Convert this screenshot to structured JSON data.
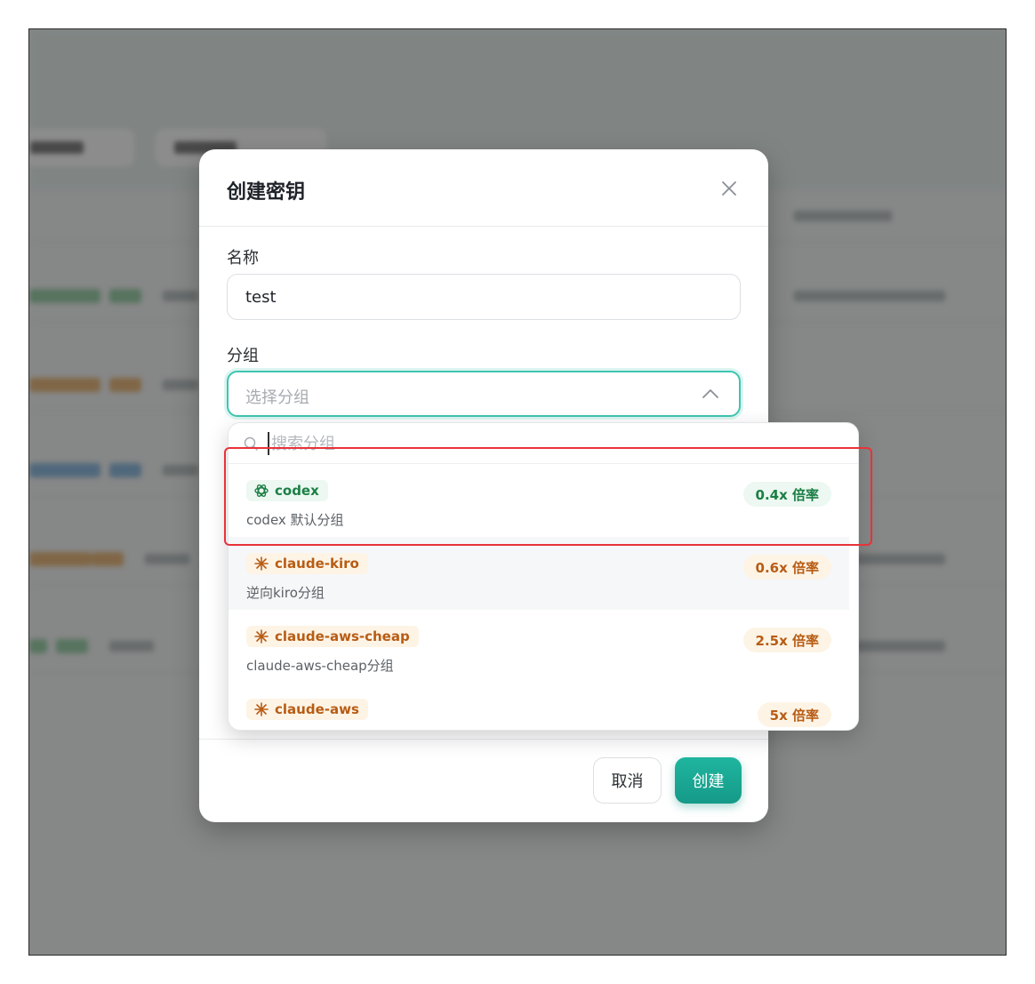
{
  "modal": {
    "title": "创建密钥",
    "name_label": "名称",
    "name_value": "test",
    "group_label": "分组",
    "group_placeholder": "选择分组",
    "cancel_label": "取消",
    "create_label": "创建"
  },
  "dropdown": {
    "search_placeholder": "搜索分组",
    "items": [
      {
        "name": "codex",
        "desc": "codex 默认分组",
        "rate": "0.4x 倍率",
        "icon": "openai-icon",
        "color": "#1b7f45"
      },
      {
        "name": "claude-kiro",
        "desc": "逆向kiro分组",
        "rate": "0.6x 倍率",
        "icon": "claude-sunburst-icon",
        "color": "#b85c14"
      },
      {
        "name": "claude-aws-cheap",
        "desc": "claude-aws-cheap分组",
        "rate": "2.5x 倍率",
        "icon": "claude-sunburst-icon",
        "color": "#b85c14"
      },
      {
        "name": "claude-aws",
        "desc": "",
        "rate": "5x 倍率",
        "icon": "claude-sunburst-icon",
        "color": "#b85c14"
      }
    ]
  },
  "colors": {
    "accent": "#1fb59f",
    "highlight": "#e8323a"
  }
}
